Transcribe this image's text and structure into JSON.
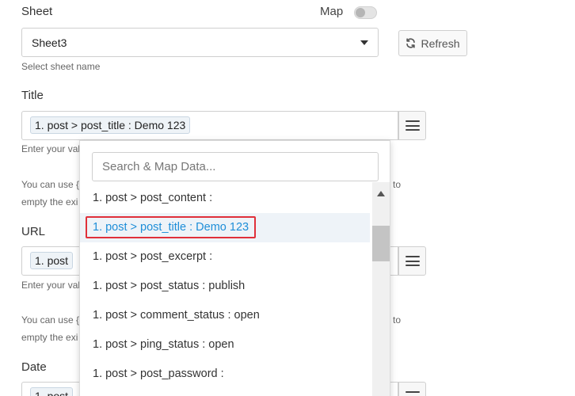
{
  "sheet": {
    "label": "Sheet",
    "map_label": "Map",
    "selected": "Sheet3",
    "hint": "Select sheet name",
    "refresh_label": "Refresh"
  },
  "title_field": {
    "label": "Title",
    "tag": "1. post > post_title : Demo 123",
    "hint": "Enter your val"
  },
  "info": {
    "line1": "You can use {",
    "line1_end": "to",
    "line2": "empty the exi"
  },
  "url_field": {
    "label": "URL",
    "tag": "1. post",
    "hint": "Enter your val"
  },
  "info2": {
    "line1": "You can use {",
    "line1_end": "to",
    "line2": "empty the exi"
  },
  "date_field": {
    "label": "Date",
    "tag": "1. post"
  },
  "dropdown": {
    "search_placeholder": "Search & Map Data...",
    "items": [
      "1. post > post_content :",
      "1. post > post_title : Demo 123",
      "1. post > post_excerpt :",
      "1. post > post_status : publish",
      "1. post > comment_status : open",
      "1. post > ping_status : open",
      "1. post > post_password :"
    ],
    "highlight_index": 1
  },
  "colors": {
    "highlight_text": "#1e8ed8",
    "highlight_border": "#e0303a"
  }
}
